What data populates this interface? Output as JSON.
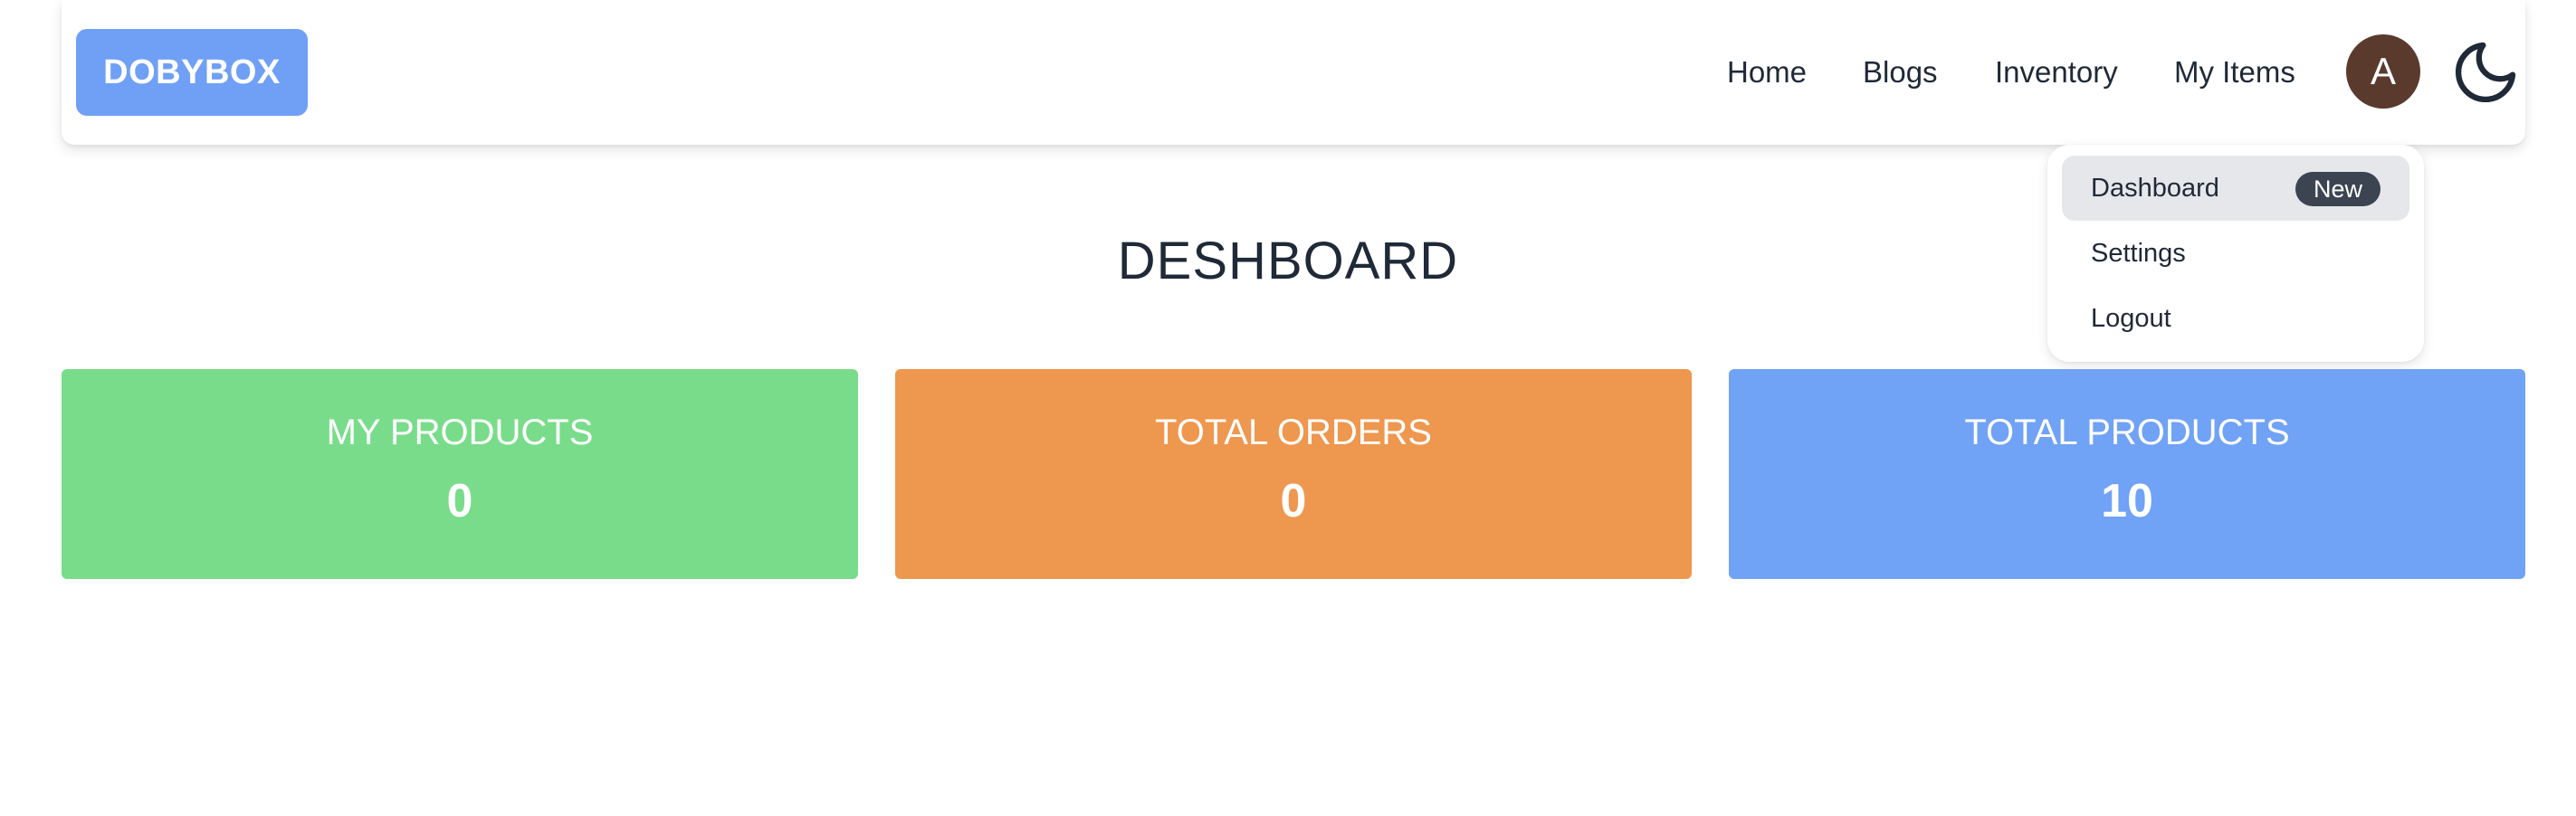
{
  "navbar": {
    "brand": "DOBYBOX",
    "links": [
      "Home",
      "Blogs",
      "Inventory",
      "My Items"
    ],
    "avatar_initial": "A",
    "theme_icon": "moon-icon"
  },
  "dropdown": {
    "items": [
      {
        "label": "Dashboard",
        "badge": "New"
      },
      {
        "label": "Settings"
      },
      {
        "label": "Logout"
      }
    ]
  },
  "page": {
    "title": "DESHBOARD"
  },
  "stats": [
    {
      "label": "MY PRODUCTS",
      "value": "0",
      "color": "#79dc8a"
    },
    {
      "label": "TOTAL ORDERS",
      "value": "0",
      "color": "#ee974e"
    },
    {
      "label": "TOTAL PRODUCTS",
      "value": "10",
      "color": "#70a2f5"
    }
  ],
  "colors": {
    "brand": "#70a0f5",
    "avatar": "#5b3a2e",
    "badge": "#3d4451"
  }
}
